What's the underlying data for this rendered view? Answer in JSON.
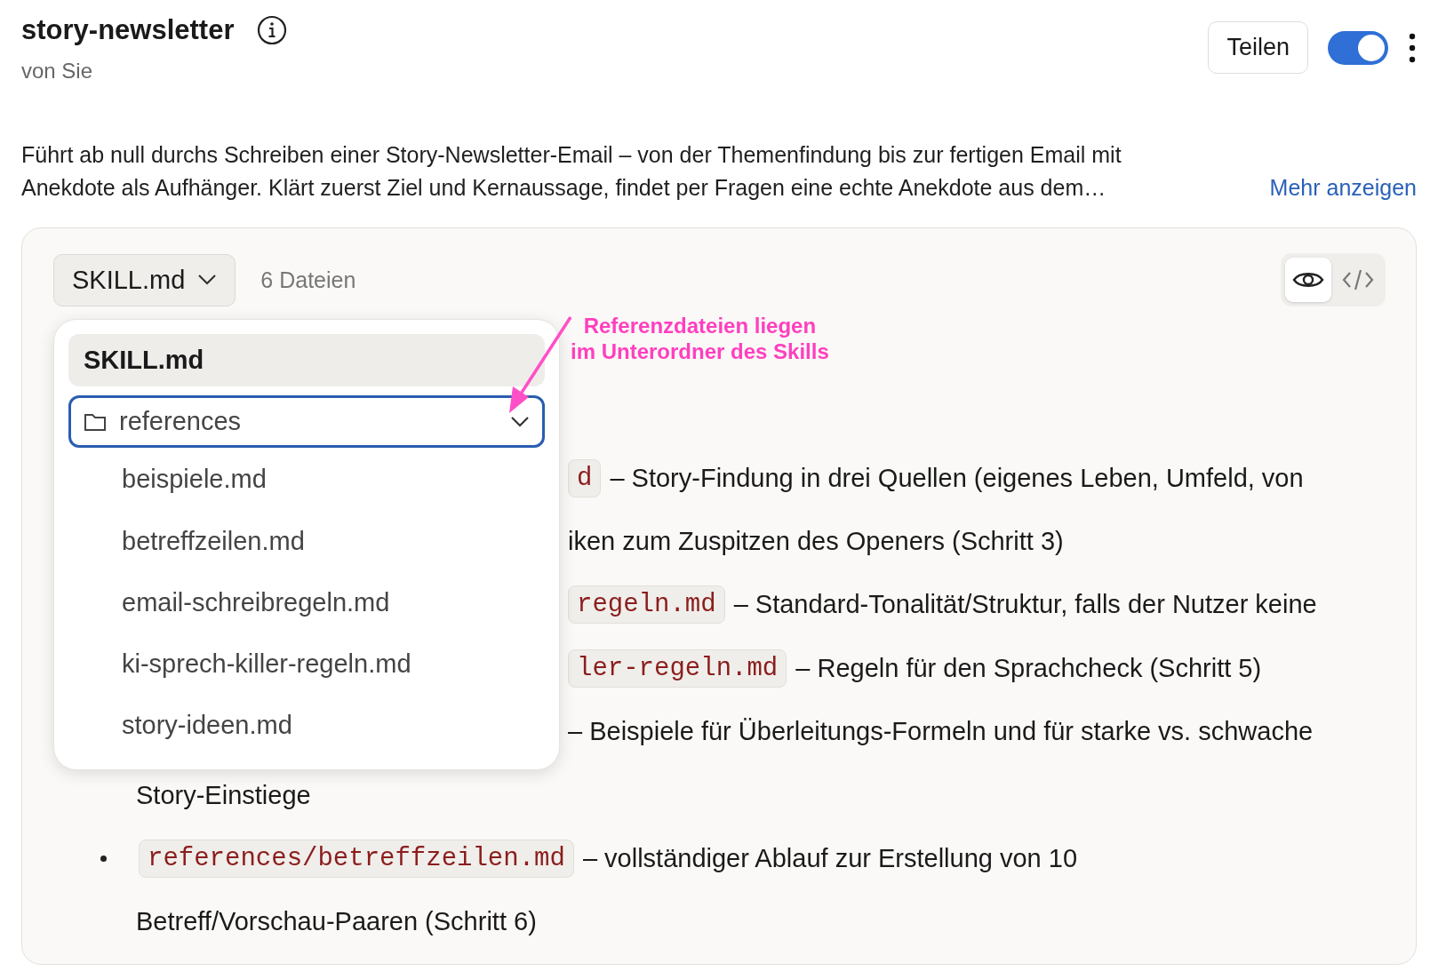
{
  "header": {
    "title": "story-newsletter",
    "author": "von Sie",
    "share_button": "Teilen",
    "toggle": {
      "on": true
    }
  },
  "description": {
    "lines": [
      "Führt ab null durchs Schreiben einer Story-Newsletter-Email – von der Themenfindung bis zur fertigen Email mit",
      "Anekdote als Aufhänger. Klärt zuerst Ziel und Kernaussage, findet per Fragen eine echte Anekdote aus dem…"
    ],
    "more_link": "Mehr anzeigen"
  },
  "viewer": {
    "file_select": "SKILL.md",
    "file_count": "6 Dateien",
    "view_modes": [
      {
        "kind": "preview",
        "selected": true
      },
      {
        "kind": "code",
        "selected": false
      }
    ],
    "lines": [
      {
        "kind": "partial",
        "code": "d",
        "text": "– Story-Findung in drei Quellen (eigenes Leben, Umfeld, von"
      },
      {
        "kind": "partial",
        "text": "iken zum Zuspitzen des Openers (Schritt 3)"
      },
      {
        "kind": "partial",
        "code": "regeln.md",
        "text": "– Standard-Tonalität/Struktur, falls der Nutzer keine"
      },
      {
        "kind": "partial",
        "code": "ler-regeln.md",
        "text": "– Regeln für den Sprachcheck (Schritt 5)"
      },
      {
        "kind": "partial",
        "text": "– Beispiele für Überleitungs-Formeln und für starke vs. schwache"
      },
      {
        "kind": "full",
        "text": "Story-Einstiege"
      },
      {
        "kind": "bullet",
        "code": "references/betreffzeilen.md",
        "text": "– vollständiger Ablauf zur Erstellung von 10"
      },
      {
        "kind": "full",
        "text": "Betreff/Vorschau-Paaren (Schritt 6)"
      }
    ],
    "menu": {
      "items": [
        {
          "kind": "file",
          "label": "SKILL.md",
          "selected": true
        },
        {
          "kind": "folder",
          "label": "references",
          "selected": false,
          "expanded": true,
          "children": [
            {
              "kind": "file",
              "label": "beispiele.md",
              "selected": false
            },
            {
              "kind": "file",
              "label": "betreffzeilen.md",
              "selected": false
            },
            {
              "kind": "file",
              "label": "email-schreibregeln.md",
              "selected": false
            },
            {
              "kind": "file",
              "label": "ki-sprech-killer-regeln.md",
              "selected": false
            },
            {
              "kind": "file",
              "label": "story-ideen.md",
              "selected": false
            }
          ]
        }
      ]
    },
    "annotation": {
      "lines": [
        "Referenzdateien liegen",
        "im Unterordner des Skills"
      ]
    }
  }
}
